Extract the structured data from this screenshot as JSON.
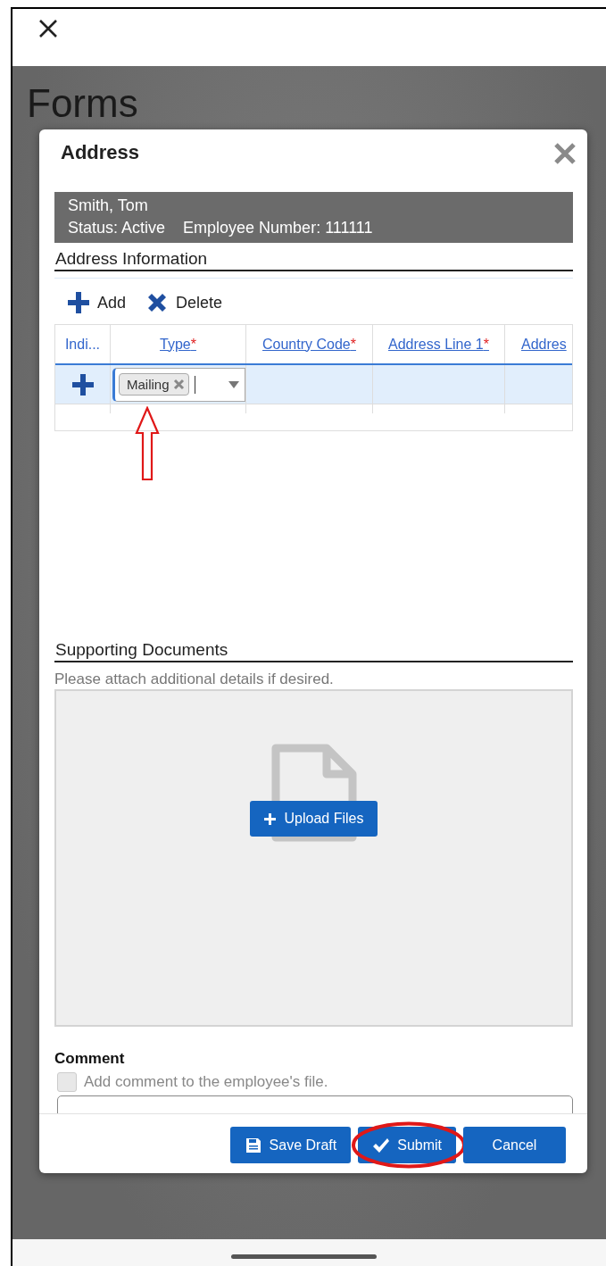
{
  "page": {
    "title": "Forms"
  },
  "dialog": {
    "title": "Address",
    "employee": {
      "name": "Smith, Tom",
      "status": "Status: Active",
      "employee_number": "Employee Number: 111111"
    },
    "address_section": {
      "title": "Address Information",
      "toolbar": [
        {
          "label": "Add",
          "kind": "add"
        },
        {
          "label": "Delete",
          "kind": "delete"
        }
      ],
      "table": {
        "required_marker": "*",
        "columns": [
          {
            "label": "Indi...",
            "required": false,
            "kind": "indicator"
          },
          {
            "label": "Type",
            "required": true,
            "kind": "link"
          },
          {
            "label": "Country Code",
            "required": true,
            "kind": "link"
          },
          {
            "label": "Address Line 1",
            "required": true,
            "kind": "link"
          },
          {
            "label": "Addres",
            "required": false,
            "kind": "link"
          }
        ],
        "rows": [
          {
            "selected": true,
            "type_field": {
              "tokens": [
                "Mailing"
              ],
              "annotated": true
            }
          },
          {
            "selected": false
          }
        ]
      }
    },
    "documents": {
      "title": "Supporting Documents",
      "hint": "Please attach additional details if desired.",
      "upload_button": "Upload Files"
    },
    "comment": {
      "title": "Comment",
      "checkbox_label": "Add comment to the employee's file.",
      "checked": false
    },
    "buttons": [
      {
        "label": "Save Draft",
        "kind": "save",
        "highlighted": false
      },
      {
        "label": "Submit",
        "kind": "submit",
        "highlighted": true
      },
      {
        "label": "Cancel",
        "kind": "cancel",
        "highlighted": false
      }
    ]
  }
}
